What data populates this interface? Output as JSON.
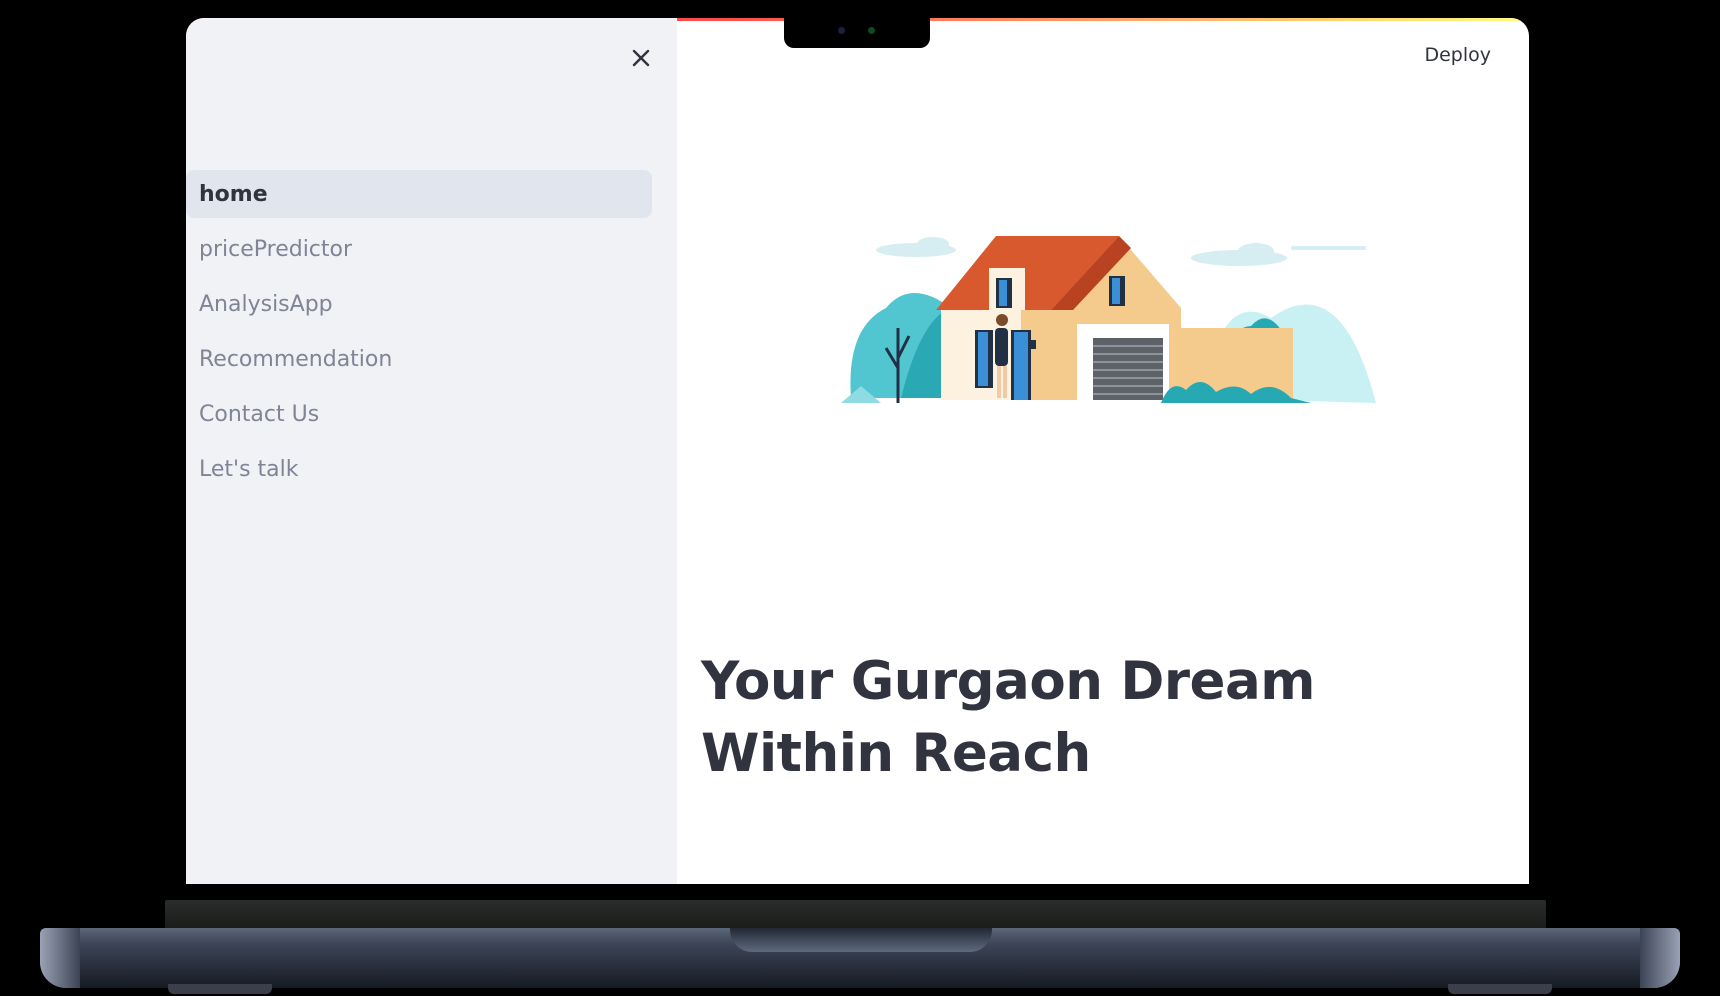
{
  "header": {
    "deploy_label": "Deploy"
  },
  "sidebar": {
    "items": [
      {
        "label": "home",
        "active": true
      },
      {
        "label": "pricePredictor",
        "active": false
      },
      {
        "label": "AnalysisApp",
        "active": false
      },
      {
        "label": "Recommendation",
        "active": false
      },
      {
        "label": "Contact Us",
        "active": false
      },
      {
        "label": "Let's talk",
        "active": false
      }
    ]
  },
  "main": {
    "title": "Your Gurgaon Dream Within Reach"
  },
  "icons": {
    "close": "close-icon",
    "hero": "house-illustration"
  },
  "colors": {
    "accent": "#ff4b4b",
    "text": "#31333f",
    "muted": "#808495",
    "sidebar_bg": "#f0f2f6",
    "active_bg": "#e1e5ed"
  }
}
